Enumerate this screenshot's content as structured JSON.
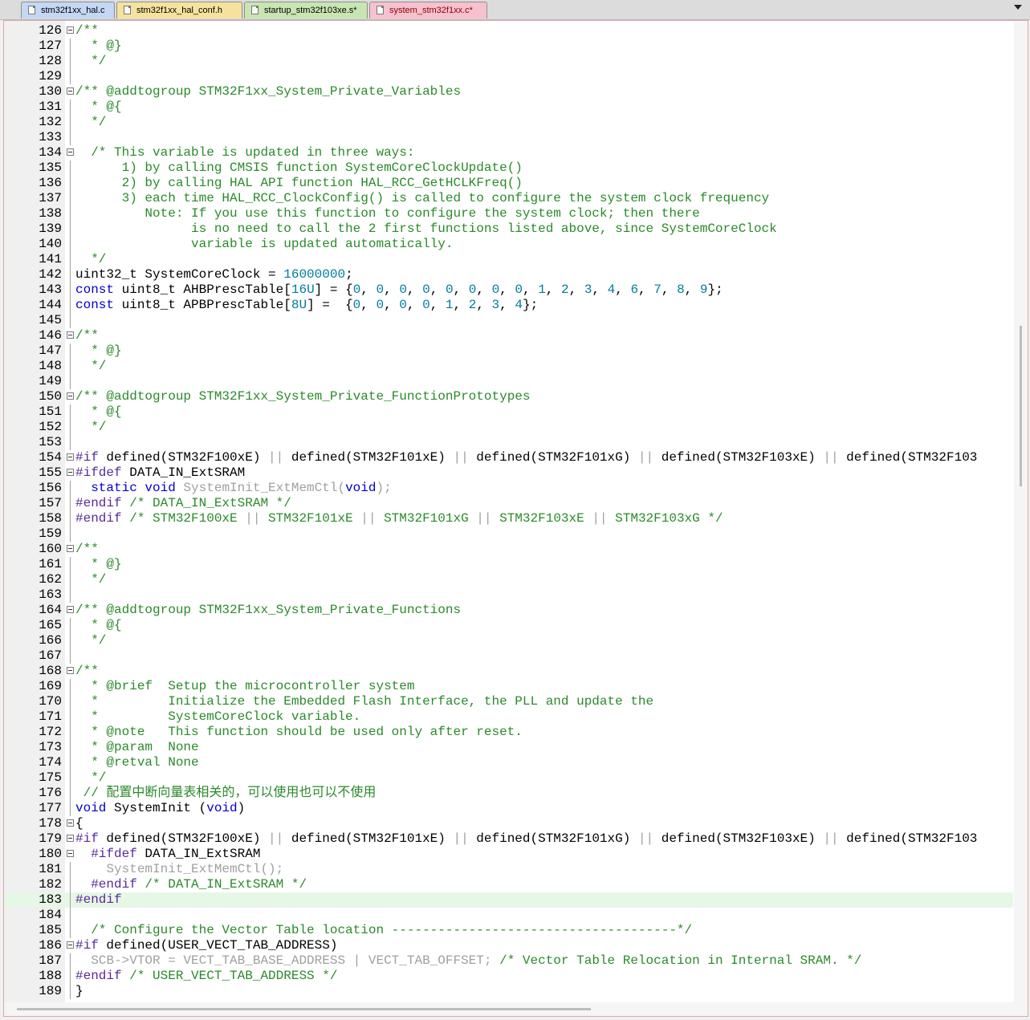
{
  "tabs": [
    {
      "label": "stm32f1xx_hal.c",
      "bg": "#c4d7f5",
      "active": false
    },
    {
      "label": "stm32f1xx_hal_conf.h",
      "bg": "#f5e39d",
      "active": false
    },
    {
      "label": "startup_stm32f103xe.s*",
      "bg": "#c9e6b2",
      "active": false
    },
    {
      "label": "system_stm32f1xx.c*",
      "bg": "#f7c1cf",
      "active": true
    }
  ],
  "dropdown_icon": "chevron-down-icon",
  "close_icon": "close-icon",
  "lines": [
    {
      "n": "126",
      "fold": true,
      "t": [
        [
          "cm",
          "/**"
        ]
      ]
    },
    {
      "n": "127",
      "t": [
        [
          "cm",
          "  * @}"
        ]
      ]
    },
    {
      "n": "128",
      "t": [
        [
          "cm",
          "  */"
        ]
      ]
    },
    {
      "n": "129",
      "t": []
    },
    {
      "n": "130",
      "fold": true,
      "t": [
        [
          "cm",
          "/** @addtogroup STM32F1xx_System_Private_Variables"
        ]
      ]
    },
    {
      "n": "131",
      "t": [
        [
          "cm",
          "  * @{"
        ]
      ]
    },
    {
      "n": "132",
      "t": [
        [
          "cm",
          "  */"
        ]
      ]
    },
    {
      "n": "133",
      "t": []
    },
    {
      "n": "134",
      "fold": true,
      "t": [
        [
          "cm",
          "  /* This variable is updated in three ways:"
        ]
      ]
    },
    {
      "n": "135",
      "t": [
        [
          "cm",
          "      1) by calling CMSIS function SystemCoreClockUpdate()"
        ]
      ]
    },
    {
      "n": "136",
      "t": [
        [
          "cm",
          "      2) by calling HAL API function HAL_RCC_GetHCLKFreq()"
        ]
      ]
    },
    {
      "n": "137",
      "t": [
        [
          "cm",
          "      3) each time HAL_RCC_ClockConfig() is called to configure the system clock frequency"
        ]
      ]
    },
    {
      "n": "138",
      "t": [
        [
          "cm",
          "         Note: If you use this function to configure the system clock; then there"
        ]
      ]
    },
    {
      "n": "139",
      "t": [
        [
          "cm",
          "               is no need to call the 2 first functions listed above, since SystemCoreClock"
        ]
      ]
    },
    {
      "n": "140",
      "t": [
        [
          "cm",
          "               variable is updated automatically."
        ]
      ]
    },
    {
      "n": "141",
      "t": [
        [
          "cm",
          "  */"
        ]
      ]
    },
    {
      "n": "142",
      "t": [
        [
          "tx",
          "uint32_t SystemCoreClock = "
        ],
        [
          "nm",
          "16000000"
        ],
        [
          "tx",
          ";"
        ]
      ]
    },
    {
      "n": "143",
      "t": [
        [
          "kw",
          "const"
        ],
        [
          "tx",
          " uint8_t AHBPrescTable["
        ],
        [
          "nm",
          "16U"
        ],
        [
          "tx",
          "] = {"
        ],
        [
          "nm",
          "0"
        ],
        [
          "tx",
          ", "
        ],
        [
          "nm",
          "0"
        ],
        [
          "tx",
          ", "
        ],
        [
          "nm",
          "0"
        ],
        [
          "tx",
          ", "
        ],
        [
          "nm",
          "0"
        ],
        [
          "tx",
          ", "
        ],
        [
          "nm",
          "0"
        ],
        [
          "tx",
          ", "
        ],
        [
          "nm",
          "0"
        ],
        [
          "tx",
          ", "
        ],
        [
          "nm",
          "0"
        ],
        [
          "tx",
          ", "
        ],
        [
          "nm",
          "0"
        ],
        [
          "tx",
          ", "
        ],
        [
          "nm",
          "1"
        ],
        [
          "tx",
          ", "
        ],
        [
          "nm",
          "2"
        ],
        [
          "tx",
          ", "
        ],
        [
          "nm",
          "3"
        ],
        [
          "tx",
          ", "
        ],
        [
          "nm",
          "4"
        ],
        [
          "tx",
          ", "
        ],
        [
          "nm",
          "6"
        ],
        [
          "tx",
          ", "
        ],
        [
          "nm",
          "7"
        ],
        [
          "tx",
          ", "
        ],
        [
          "nm",
          "8"
        ],
        [
          "tx",
          ", "
        ],
        [
          "nm",
          "9"
        ],
        [
          "tx",
          "};"
        ]
      ]
    },
    {
      "n": "144",
      "t": [
        [
          "kw",
          "const"
        ],
        [
          "tx",
          " uint8_t APBPrescTable["
        ],
        [
          "nm",
          "8U"
        ],
        [
          "tx",
          "] =  {"
        ],
        [
          "nm",
          "0"
        ],
        [
          "tx",
          ", "
        ],
        [
          "nm",
          "0"
        ],
        [
          "tx",
          ", "
        ],
        [
          "nm",
          "0"
        ],
        [
          "tx",
          ", "
        ],
        [
          "nm",
          "0"
        ],
        [
          "tx",
          ", "
        ],
        [
          "nm",
          "1"
        ],
        [
          "tx",
          ", "
        ],
        [
          "nm",
          "2"
        ],
        [
          "tx",
          ", "
        ],
        [
          "nm",
          "3"
        ],
        [
          "tx",
          ", "
        ],
        [
          "nm",
          "4"
        ],
        [
          "tx",
          "};"
        ]
      ]
    },
    {
      "n": "145",
      "t": []
    },
    {
      "n": "146",
      "fold": true,
      "t": [
        [
          "cm",
          "/**"
        ]
      ]
    },
    {
      "n": "147",
      "t": [
        [
          "cm",
          "  * @}"
        ]
      ]
    },
    {
      "n": "148",
      "t": [
        [
          "cm",
          "  */"
        ]
      ]
    },
    {
      "n": "149",
      "t": []
    },
    {
      "n": "150",
      "fold": true,
      "t": [
        [
          "cm",
          "/** @addtogroup STM32F1xx_System_Private_FunctionPrototypes"
        ]
      ]
    },
    {
      "n": "151",
      "t": [
        [
          "cm",
          "  * @{"
        ]
      ]
    },
    {
      "n": "152",
      "t": [
        [
          "cm",
          "  */"
        ]
      ]
    },
    {
      "n": "153",
      "t": []
    },
    {
      "n": "154",
      "fold": true,
      "t": [
        [
          "pp",
          "#if"
        ],
        [
          "tx",
          " defined(STM32F100xE) "
        ],
        [
          "gr",
          "||"
        ],
        [
          "tx",
          " defined(STM32F101xE) "
        ],
        [
          "gr",
          "||"
        ],
        [
          "tx",
          " defined(STM32F101xG) "
        ],
        [
          "gr",
          "||"
        ],
        [
          "tx",
          " defined(STM32F103xE) "
        ],
        [
          "gr",
          "||"
        ],
        [
          "tx",
          " defined(STM32F103"
        ]
      ]
    },
    {
      "n": "155",
      "fold": true,
      "t": [
        [
          "pp",
          "#ifdef"
        ],
        [
          "tx",
          " DATA_IN_ExtSRAM"
        ]
      ]
    },
    {
      "n": "156",
      "t": [
        [
          "kw",
          "  static void"
        ],
        [
          "gr",
          " SystemInit_ExtMemCtl("
        ],
        [
          "kw",
          "void"
        ],
        [
          "gr",
          ");"
        ]
      ]
    },
    {
      "n": "157",
      "t": [
        [
          "pp",
          "#endif"
        ],
        [
          "cm",
          " /* DATA_IN_ExtSRAM */"
        ]
      ]
    },
    {
      "n": "158",
      "t": [
        [
          "pp",
          "#endif"
        ],
        [
          "cm",
          " /* STM32F100xE "
        ],
        [
          "gr",
          "||"
        ],
        [
          "cm",
          " STM32F101xE "
        ],
        [
          "gr",
          "||"
        ],
        [
          "cm",
          " STM32F101xG "
        ],
        [
          "gr",
          "||"
        ],
        [
          "cm",
          " STM32F103xE "
        ],
        [
          "gr",
          "||"
        ],
        [
          "cm",
          " STM32F103xG */"
        ]
      ]
    },
    {
      "n": "159",
      "t": []
    },
    {
      "n": "160",
      "fold": true,
      "t": [
        [
          "cm",
          "/**"
        ]
      ]
    },
    {
      "n": "161",
      "t": [
        [
          "cm",
          "  * @}"
        ]
      ]
    },
    {
      "n": "162",
      "t": [
        [
          "cm",
          "  */"
        ]
      ]
    },
    {
      "n": "163",
      "t": []
    },
    {
      "n": "164",
      "fold": true,
      "t": [
        [
          "cm",
          "/** @addtogroup STM32F1xx_System_Private_Functions"
        ]
      ]
    },
    {
      "n": "165",
      "t": [
        [
          "cm",
          "  * @{"
        ]
      ]
    },
    {
      "n": "166",
      "t": [
        [
          "cm",
          "  */"
        ]
      ]
    },
    {
      "n": "167",
      "t": []
    },
    {
      "n": "168",
      "fold": true,
      "t": [
        [
          "cm",
          "/**"
        ]
      ]
    },
    {
      "n": "169",
      "t": [
        [
          "cm",
          "  * @brief  Setup the microcontroller system"
        ]
      ]
    },
    {
      "n": "170",
      "t": [
        [
          "cm",
          "  *         Initialize the Embedded Flash Interface, the PLL and update the"
        ]
      ]
    },
    {
      "n": "171",
      "t": [
        [
          "cm",
          "  *         SystemCoreClock variable."
        ]
      ]
    },
    {
      "n": "172",
      "t": [
        [
          "cm",
          "  * @note   This function should be used only after reset."
        ]
      ]
    },
    {
      "n": "173",
      "t": [
        [
          "cm",
          "  * @param  None"
        ]
      ]
    },
    {
      "n": "174",
      "t": [
        [
          "cm",
          "  * @retval None"
        ]
      ]
    },
    {
      "n": "175",
      "t": [
        [
          "cm",
          "  */"
        ]
      ]
    },
    {
      "n": "176",
      "t": [
        [
          "cm",
          " // 配置中断向量表相关的，可以使用也可以不使用"
        ]
      ]
    },
    {
      "n": "177",
      "t": [
        [
          "kw",
          "void"
        ],
        [
          "tx",
          " SystemInit ("
        ],
        [
          "kw",
          "void"
        ],
        [
          "tx",
          ")"
        ]
      ]
    },
    {
      "n": "178",
      "fold": true,
      "t": [
        [
          "tx",
          "{"
        ]
      ]
    },
    {
      "n": "179",
      "fold": true,
      "t": [
        [
          "pp",
          "#if"
        ],
        [
          "tx",
          " defined(STM32F100xE) "
        ],
        [
          "gr",
          "||"
        ],
        [
          "tx",
          " defined(STM32F101xE) "
        ],
        [
          "gr",
          "||"
        ],
        [
          "tx",
          " defined(STM32F101xG) "
        ],
        [
          "gr",
          "||"
        ],
        [
          "tx",
          " defined(STM32F103xE) "
        ],
        [
          "gr",
          "||"
        ],
        [
          "tx",
          " defined(STM32F103"
        ]
      ]
    },
    {
      "n": "180",
      "fold": true,
      "t": [
        [
          "pp",
          "  #ifdef"
        ],
        [
          "tx",
          " DATA_IN_ExtSRAM"
        ]
      ]
    },
    {
      "n": "181",
      "t": [
        [
          "gr",
          "    SystemInit_ExtMemCtl();"
        ]
      ]
    },
    {
      "n": "182",
      "t": [
        [
          "pp",
          "  #endif"
        ],
        [
          "cm",
          " /* DATA_IN_ExtSRAM */"
        ]
      ]
    },
    {
      "n": "183",
      "hl": true,
      "t": [
        [
          "pp",
          "#endif"
        ]
      ]
    },
    {
      "n": "184",
      "t": []
    },
    {
      "n": "185",
      "t": [
        [
          "cm",
          "  /* Configure the Vector Table location -------------------------------------*/"
        ]
      ]
    },
    {
      "n": "186",
      "fold": true,
      "t": [
        [
          "pp",
          "#if"
        ],
        [
          "tx",
          " defined(USER_VECT_TAB_ADDRESS)"
        ]
      ]
    },
    {
      "n": "187",
      "t": [
        [
          "gr",
          "  SCB->VTOR = VECT_TAB_BASE_ADDRESS | VECT_TAB_OFFSET; "
        ],
        [
          "cm",
          "/* Vector Table Relocation in Internal SRAM. */"
        ]
      ]
    },
    {
      "n": "188",
      "t": [
        [
          "pp",
          "#endif"
        ],
        [
          "cm",
          " /* USER_VECT_TAB_ADDRESS */"
        ]
      ]
    },
    {
      "n": "189",
      "t": [
        [
          "tx",
          "}"
        ]
      ]
    }
  ]
}
